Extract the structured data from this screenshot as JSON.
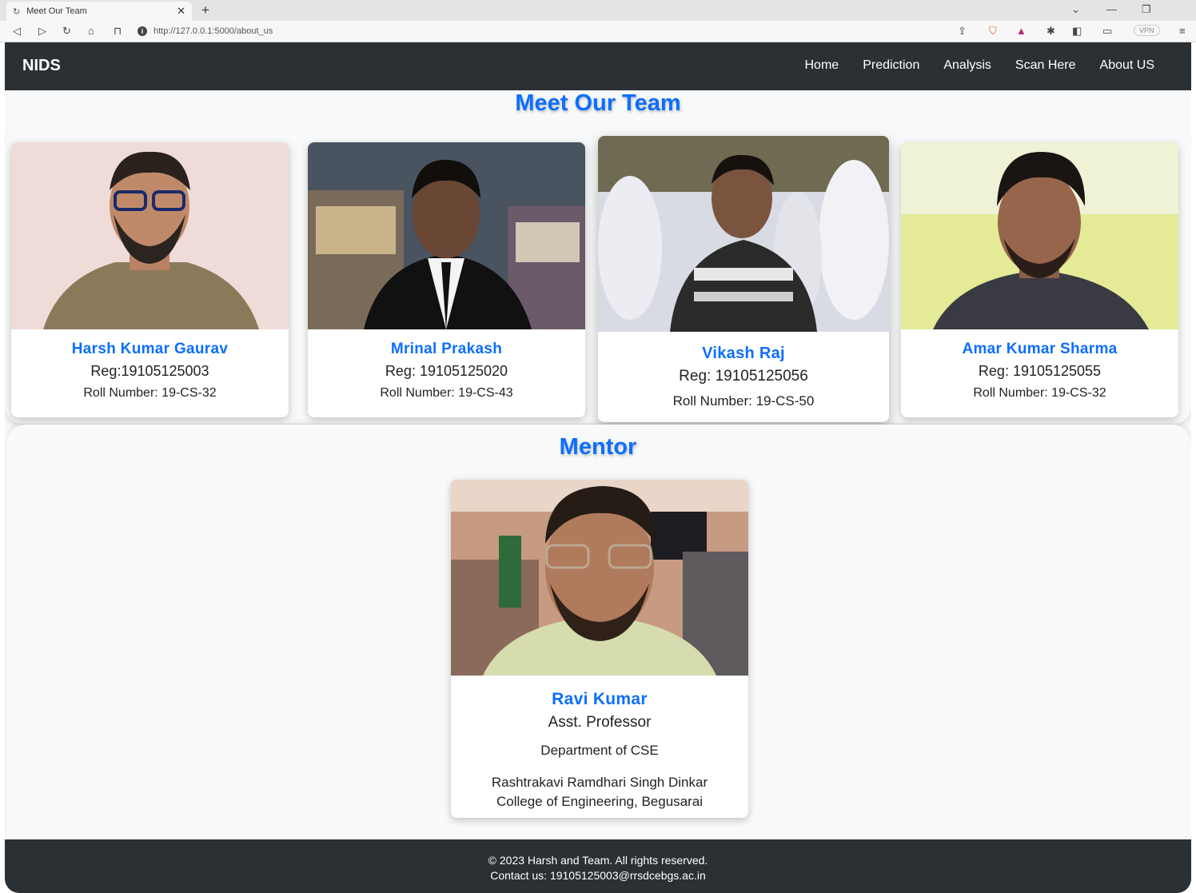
{
  "browser": {
    "tab_title": "Meet Our Team",
    "url": "http://127.0.0.1:5000/about_us",
    "vpn_label": "VPN"
  },
  "navbar": {
    "brand": "NIDS",
    "links": [
      "Home",
      "Prediction",
      "Analysis",
      "Scan Here",
      "About US"
    ]
  },
  "team_section": {
    "title": "Meet Our Team",
    "members": [
      {
        "name": "Harsh Kumar Gaurav",
        "reg": "Reg:19105125003",
        "roll": "Roll Number: 19-CS-32"
      },
      {
        "name": "Mrinal Prakash",
        "reg": "Reg: 19105125020",
        "roll": "Roll Number: 19-CS-43"
      },
      {
        "name": "Vikash Raj",
        "reg": "Reg: 19105125056",
        "roll": "Roll Number: 19-CS-50"
      },
      {
        "name": "Amar Kumar Sharma",
        "reg": "Reg: 19105125055",
        "roll": "Roll Number: 19-CS-32"
      }
    ]
  },
  "mentor_section": {
    "title": "Mentor",
    "name": "Ravi Kumar",
    "designation": "Asst. Professor",
    "department": "Department of CSE",
    "college_line1": "Rashtrakavi Ramdhari Singh Dinkar",
    "college_line2": "College of Engineering, Begusarai"
  },
  "footer": {
    "copyright": "© 2023 Harsh and Team. All rights reserved.",
    "contact": "Contact us: 19105125003@rrsdcebgs.ac.in"
  }
}
